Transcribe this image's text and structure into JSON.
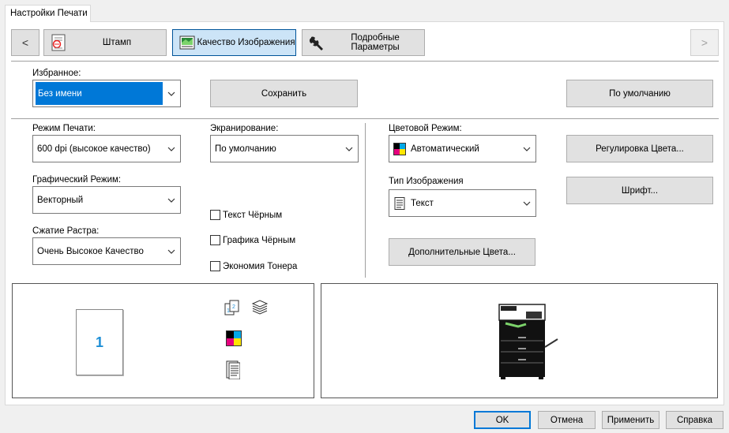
{
  "tab": {
    "label": "Настройки Печати"
  },
  "toolbar": {
    "prev_label": "<",
    "next_label": ">",
    "stamp_label": "Штамп",
    "quality_label": "Качество Изображения",
    "detail_label": "Подробные Параметры",
    "active_tab": "quality"
  },
  "favorites": {
    "label": "Избранное:",
    "value": "Без имени",
    "save_label": "Сохранить",
    "default_label": "По умолчанию"
  },
  "print_mode": {
    "label": "Режим Печати:",
    "value": "600 dpi (высокое качество)"
  },
  "screening": {
    "label": "Экранирование:",
    "value": "По умолчанию"
  },
  "graphic_mode": {
    "label": "Графический Режим:",
    "value": "Векторный"
  },
  "raster_compression": {
    "label": "Сжатие Растра:",
    "value": "Очень Высокое Качество"
  },
  "checkboxes": {
    "text_black": {
      "label": "Текст Чёрным",
      "checked": false
    },
    "graphics_black": {
      "label": "Графика Чёрным",
      "checked": false
    },
    "toner_save": {
      "label": "Экономия Тонера",
      "checked": false
    }
  },
  "color_mode": {
    "label": "Цветовой Режим:",
    "value": "Автоматический",
    "icon": "cmyk-grid-icon"
  },
  "image_type": {
    "label": "Тип Изображения",
    "value": "Текст",
    "icon": "document-icon"
  },
  "buttons": {
    "color_adjust": "Регулировка Цвета...",
    "font": "Шрифт...",
    "extra_colors": "Дополнительные Цвета..."
  },
  "preview": {
    "page_number": "1"
  },
  "footer": {
    "ok": "OK",
    "cancel": "Отмена",
    "apply": "Применить",
    "help": "Справка"
  },
  "colors": {
    "accent": "#0078d7",
    "active_tab_bg": "#cce4f7",
    "page_number": "#1e8fd6"
  }
}
